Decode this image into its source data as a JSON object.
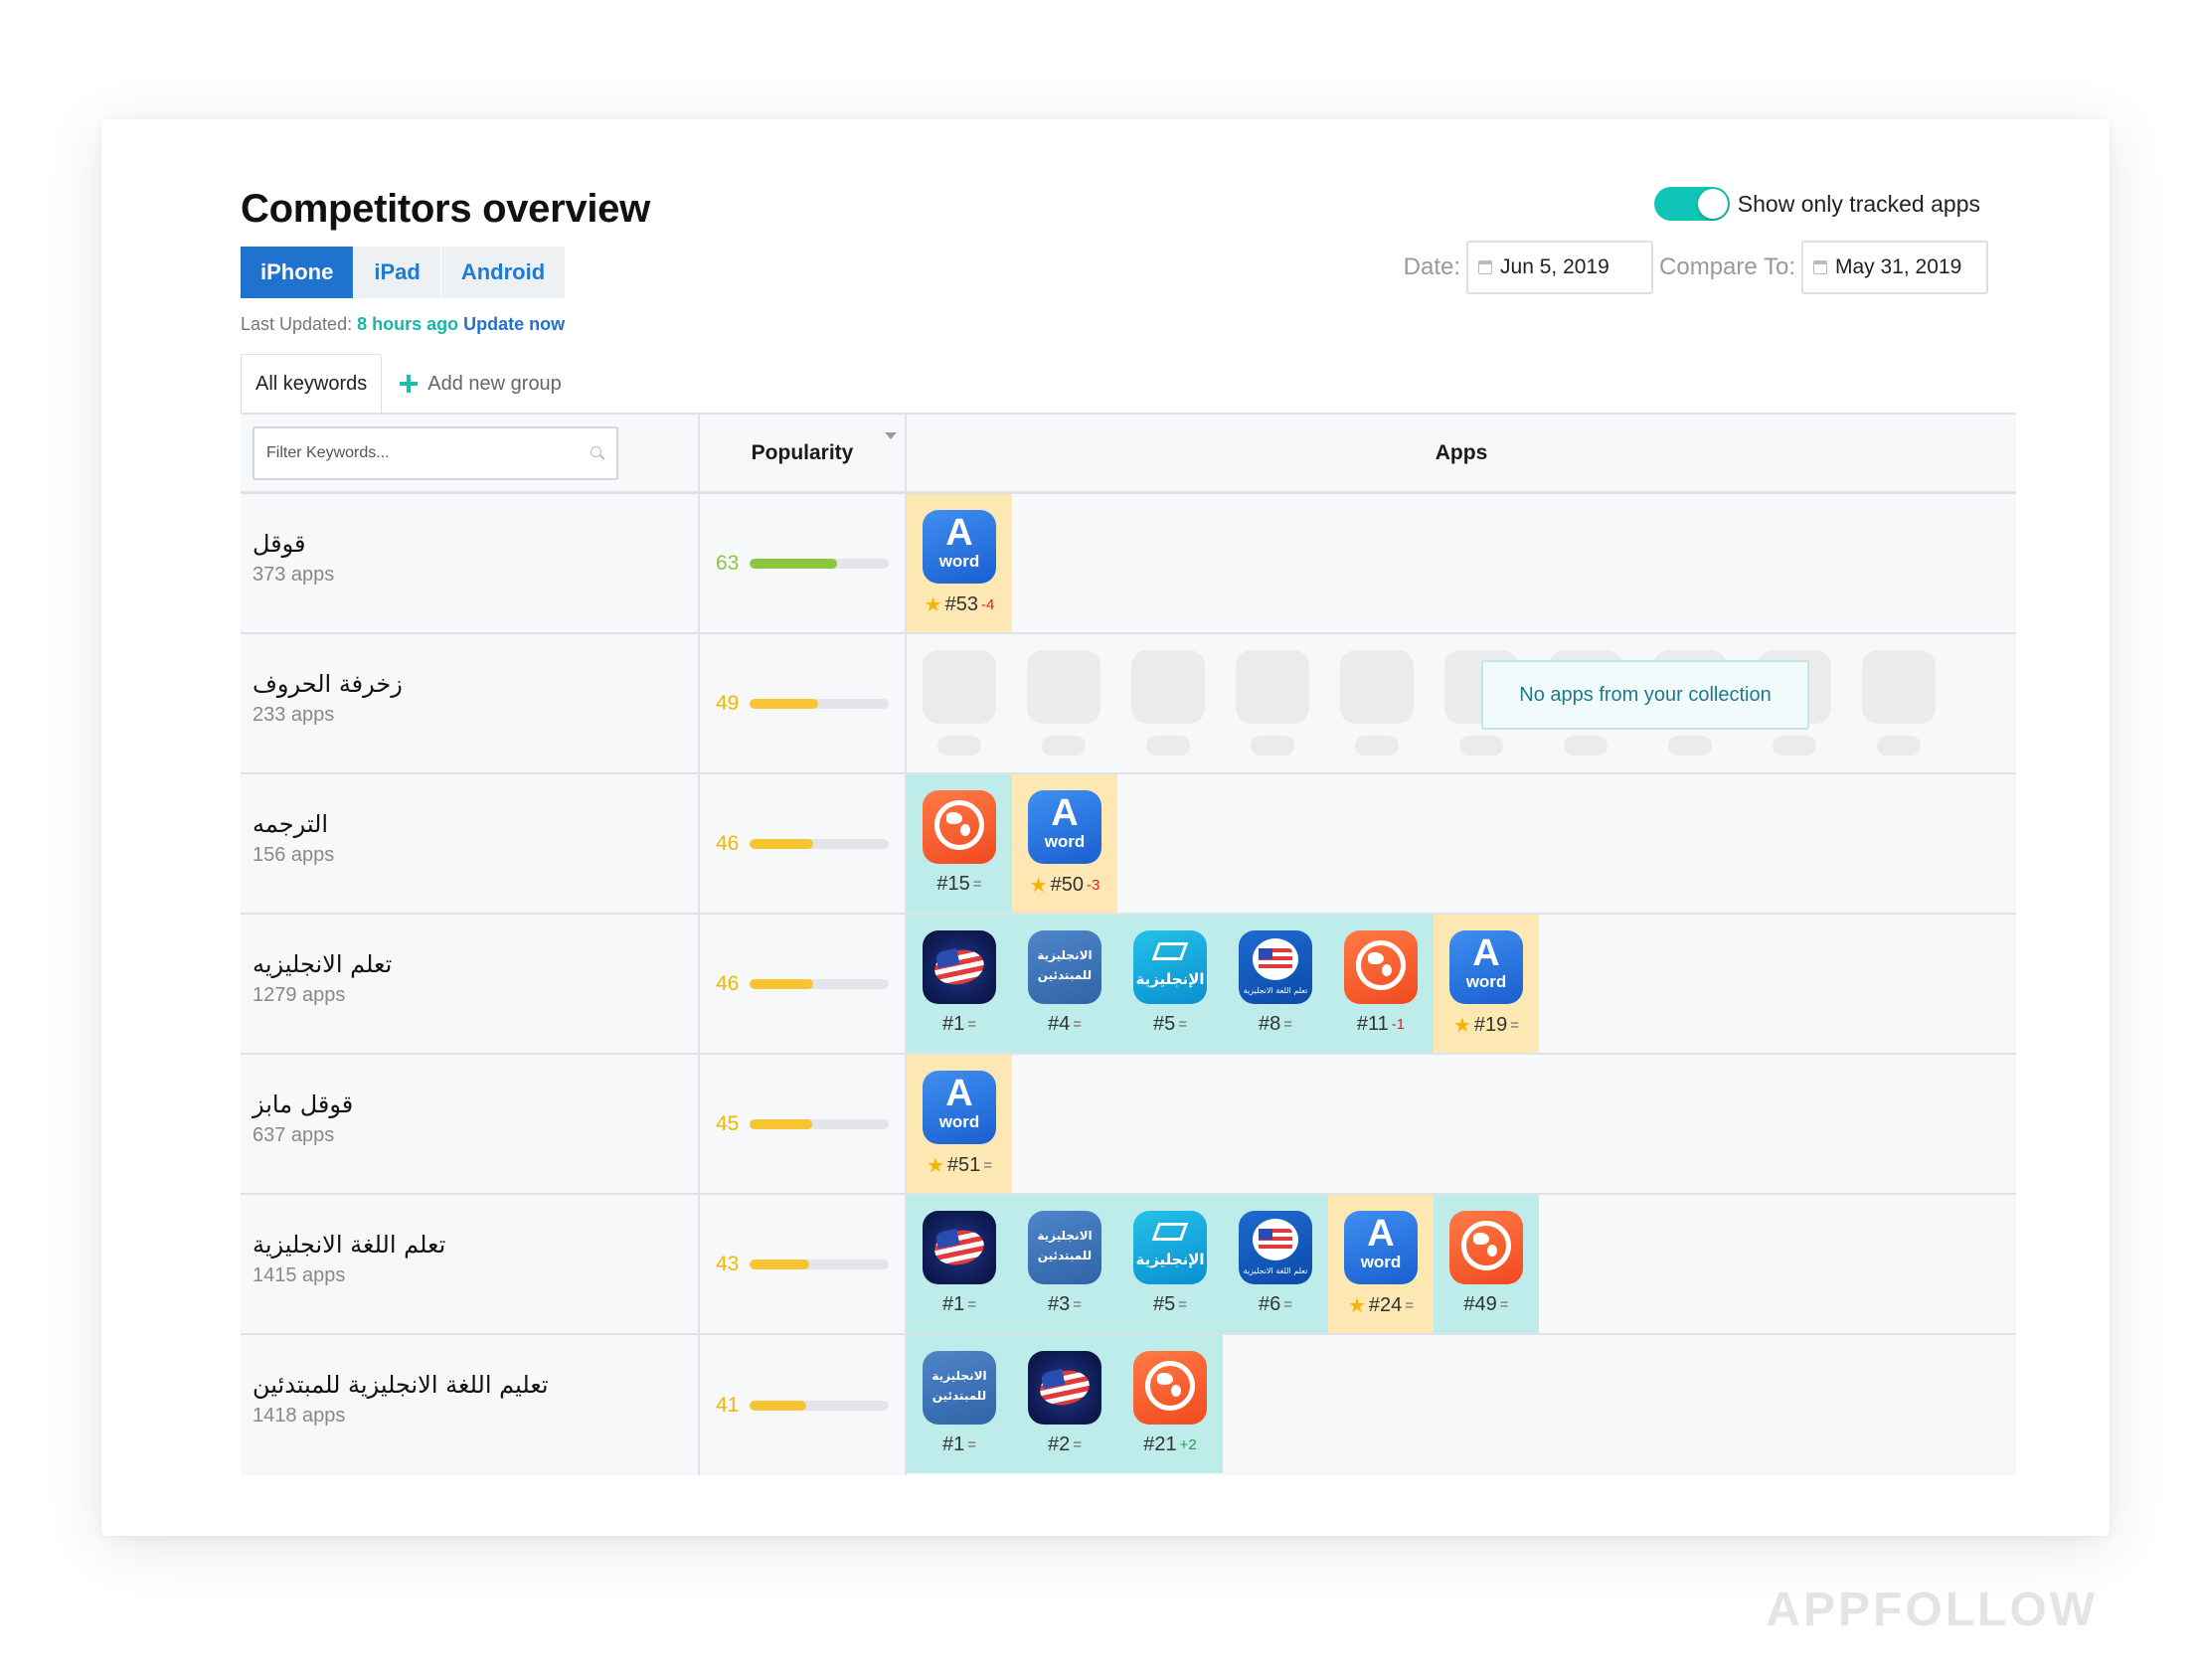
{
  "header": {
    "title": "Competitors overview",
    "toggle_label": "Show only tracked apps"
  },
  "device_tabs": [
    {
      "label": "iPhone",
      "active": true
    },
    {
      "label": "iPad",
      "active": false
    },
    {
      "label": "Android",
      "active": false
    }
  ],
  "last_updated": {
    "prefix": "Last Updated:",
    "ago": "8 hours ago",
    "action": "Update now"
  },
  "dates": {
    "date_label": "Date:",
    "date_value": "Jun 5, 2019",
    "compare_label": "Compare To:",
    "compare_value": "May 31, 2019"
  },
  "group_tabs": {
    "all": "All keywords",
    "add": "Add new group"
  },
  "table": {
    "filter_placeholder": "Filter Keywords...",
    "popularity_header": "Popularity",
    "apps_header": "Apps",
    "no_apps_message": "No apps from your collection",
    "rows": [
      {
        "keyword": "قوقل",
        "apps": "373 apps",
        "popularity": "63"
      },
      {
        "keyword": "زخرفة الحروف",
        "apps": "233 apps",
        "popularity": "49"
      },
      {
        "keyword": "الترجمه",
        "apps": "156 apps",
        "popularity": "46"
      },
      {
        "keyword": "تعلم الانجليزيه",
        "apps": "1279 apps",
        "popularity": "46"
      },
      {
        "keyword": "قوقل مابز",
        "apps": "637 apps",
        "popularity": "45"
      },
      {
        "keyword": "تعلم اللغة الانجليزية",
        "apps": "1415 apps",
        "popularity": "43"
      },
      {
        "keyword": "تعليم اللغة الانجليزية للمبتدئين",
        "apps": "1418 apps",
        "popularity": "41"
      }
    ]
  },
  "app_ranks": {
    "r0": [
      {
        "rank": "#53",
        "change": "-4"
      }
    ],
    "r2": [
      {
        "rank": "#15",
        "change": "="
      },
      {
        "rank": "#50",
        "change": "-3"
      }
    ],
    "r3": [
      {
        "rank": "#1",
        "change": "="
      },
      {
        "rank": "#4",
        "change": "="
      },
      {
        "rank": "#5",
        "change": "="
      },
      {
        "rank": "#8",
        "change": "="
      },
      {
        "rank": "#11",
        "change": "-1"
      },
      {
        "rank": "#19",
        "change": "="
      }
    ],
    "r4": [
      {
        "rank": "#51",
        "change": "="
      }
    ],
    "r5": [
      {
        "rank": "#1",
        "change": "="
      },
      {
        "rank": "#3",
        "change": "="
      },
      {
        "rank": "#5",
        "change": "="
      },
      {
        "rank": "#6",
        "change": "="
      },
      {
        "rank": "#24",
        "change": "="
      },
      {
        "rank": "#49",
        "change": "="
      }
    ],
    "r6": [
      {
        "rank": "#1",
        "change": "="
      },
      {
        "rank": "#2",
        "change": "="
      },
      {
        "rank": "#21",
        "change": "+2"
      }
    ]
  },
  "icon_text": {
    "word_big": "A",
    "word_small": "word",
    "arabic_line1": "الانجليزية",
    "arabic_line2": "للمبتدئين",
    "grad_text": "الإنجليزية",
    "usbubble_text": "تعلم اللغة الانجليزية"
  },
  "colors": {
    "accent": "#1f73cf",
    "toggle_on": "#10c5b5",
    "collection_bg": "#bdeceb",
    "own_bg": "#fde7b3",
    "pop_high": "#8cc63f",
    "pop_mid": "#f7c531"
  },
  "brand": "APPFOLLOW"
}
